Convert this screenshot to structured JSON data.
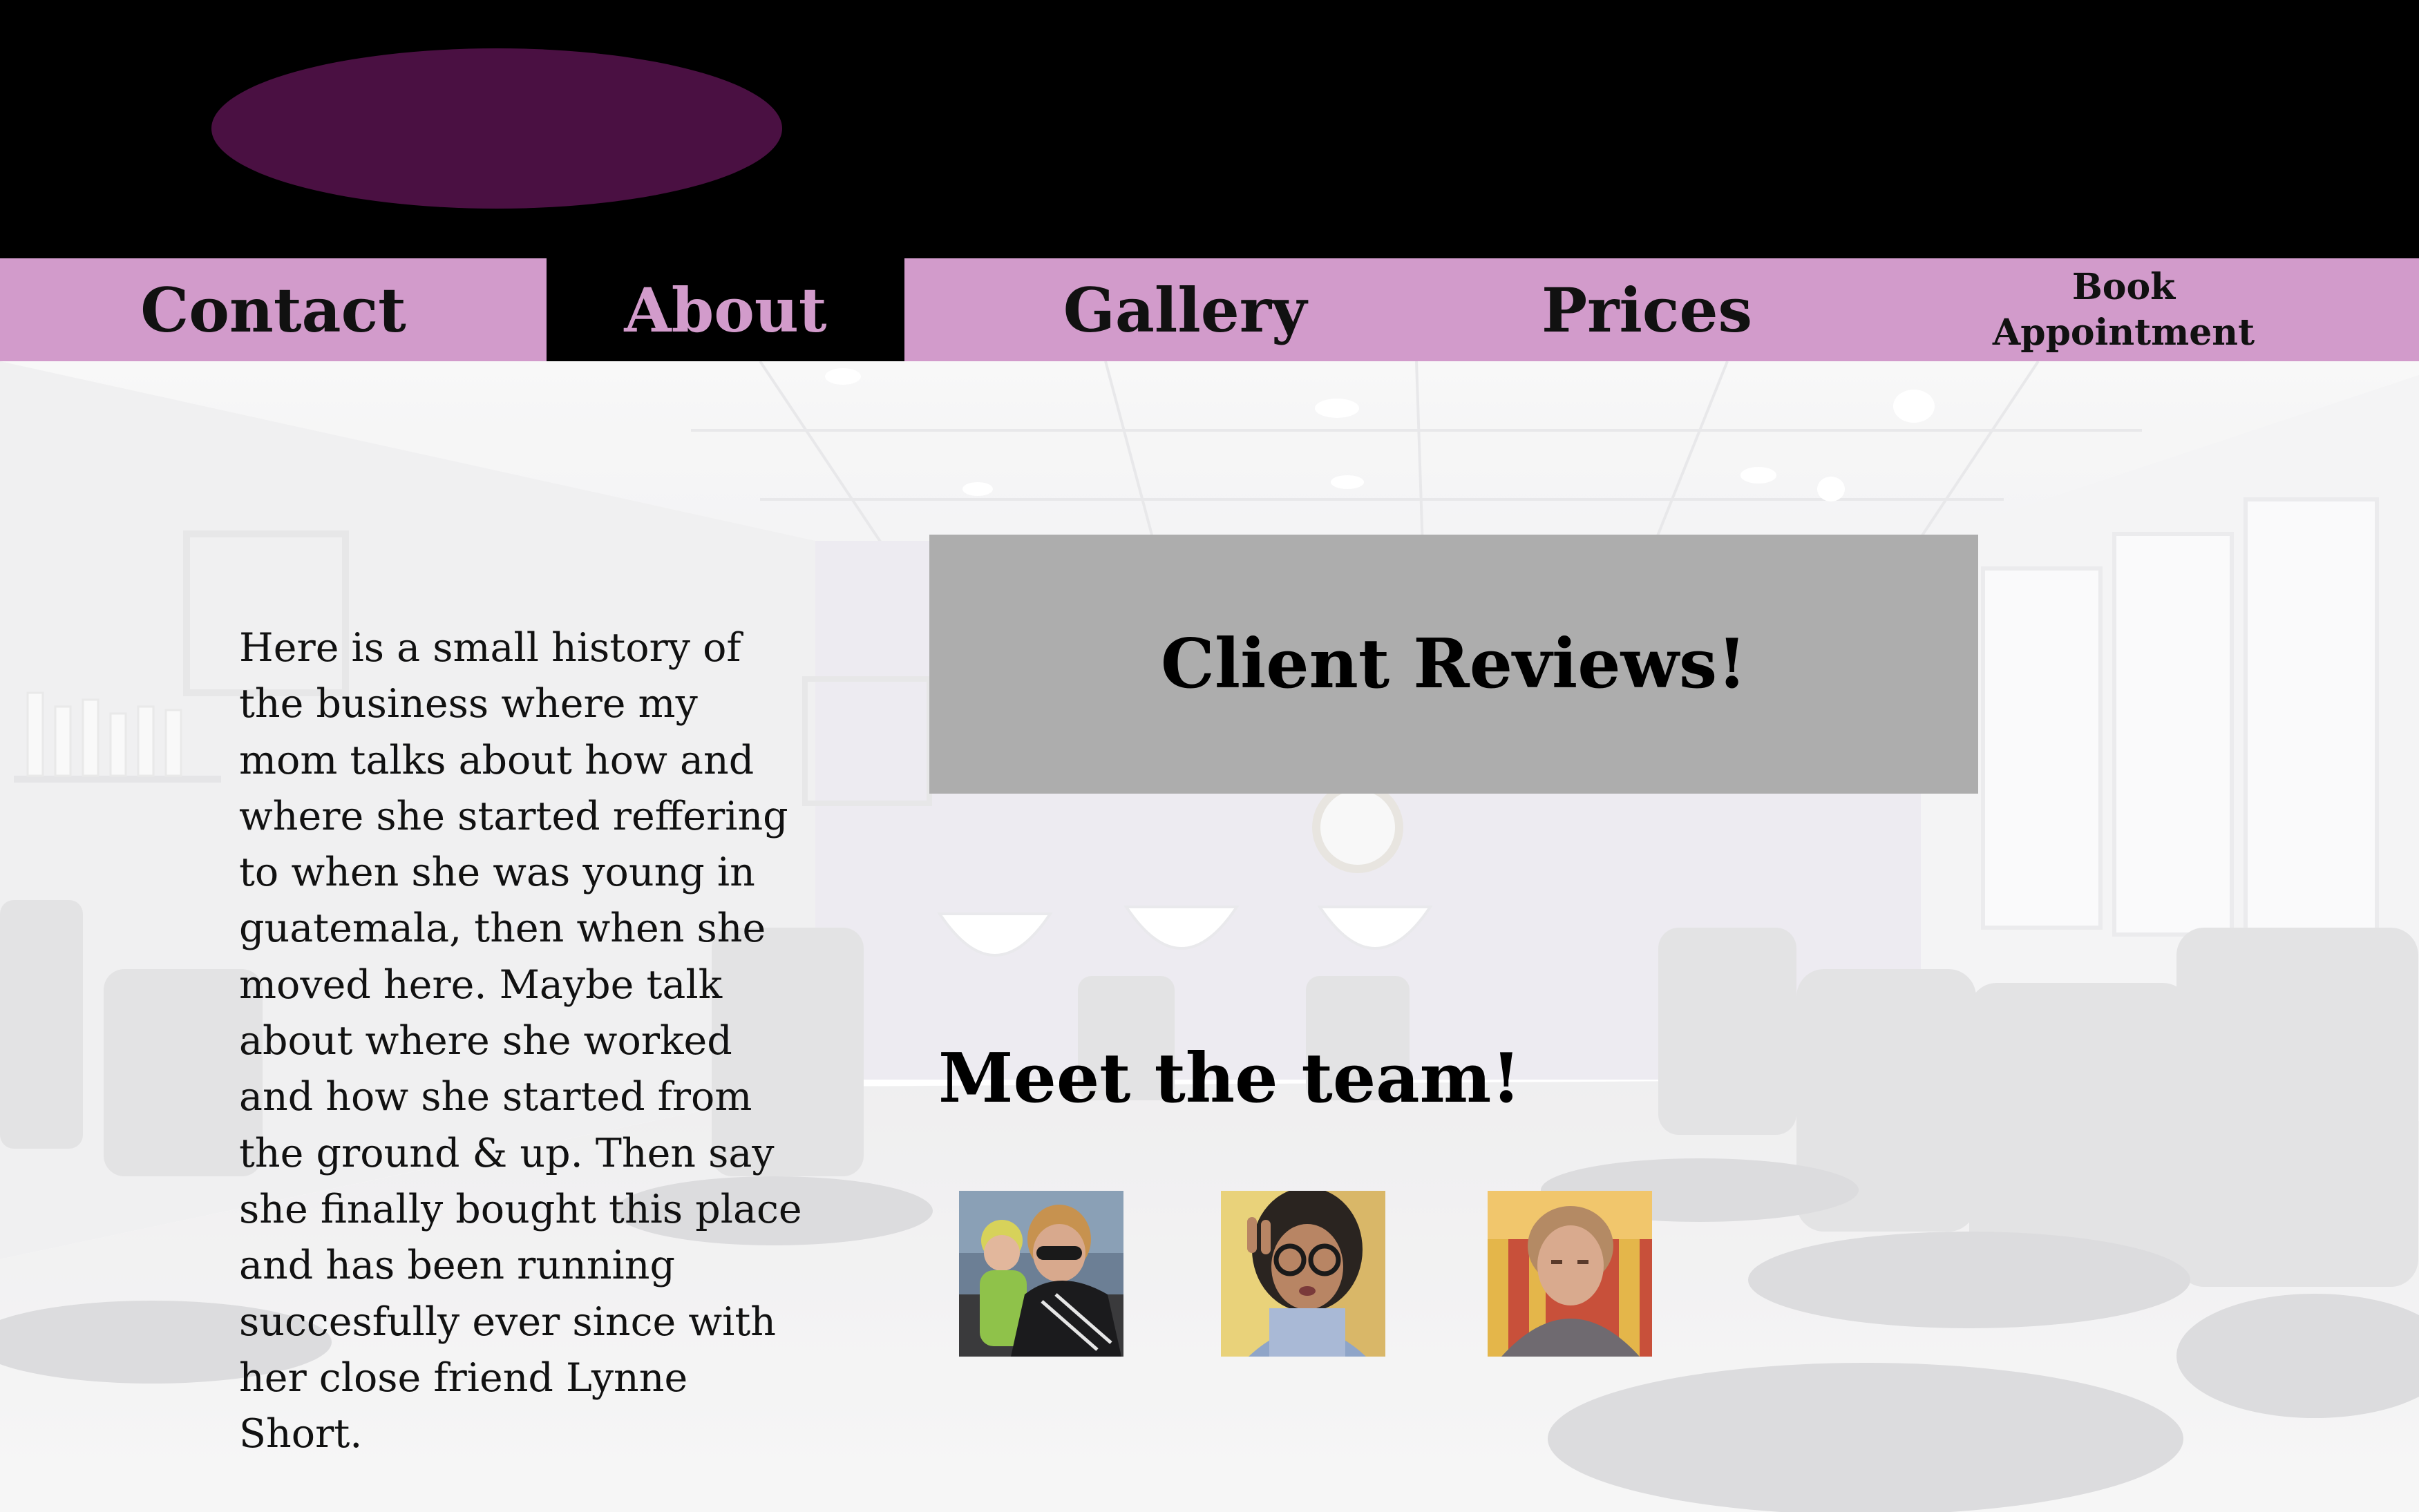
{
  "colors": {
    "header_bg": "#000000",
    "logo": "#4a1042",
    "nav_bg": "#d29bcb",
    "nav_active_bg": "#000000",
    "nav_text": "#111111",
    "nav_active_text": "#d29bcb",
    "reviews_box": "#adadad"
  },
  "header": {
    "logo_icon": "logo-oval"
  },
  "nav": {
    "items": [
      {
        "label": "Contact",
        "active": false
      },
      {
        "label": "About",
        "active": true
      },
      {
        "label": "Gallery",
        "active": false
      },
      {
        "label": "Prices",
        "active": false
      },
      {
        "label": "Book\nAppointment",
        "active": false
      }
    ]
  },
  "about": {
    "history_text": "Here is a small history of the business where my mom talks about how and where she started reffering to when she was young in guatemala, then when she moved here. Maybe talk about where she worked and how she started from the ground & up. Then say she finally bought this place and has been running succesfully ever since with her close friend Lynne Short."
  },
  "reviews": {
    "title": "Client Reviews!"
  },
  "team": {
    "title": "Meet the team!",
    "members": [
      {
        "photo": "team-photo-1"
      },
      {
        "photo": "team-photo-2"
      },
      {
        "photo": "team-photo-3"
      }
    ]
  }
}
